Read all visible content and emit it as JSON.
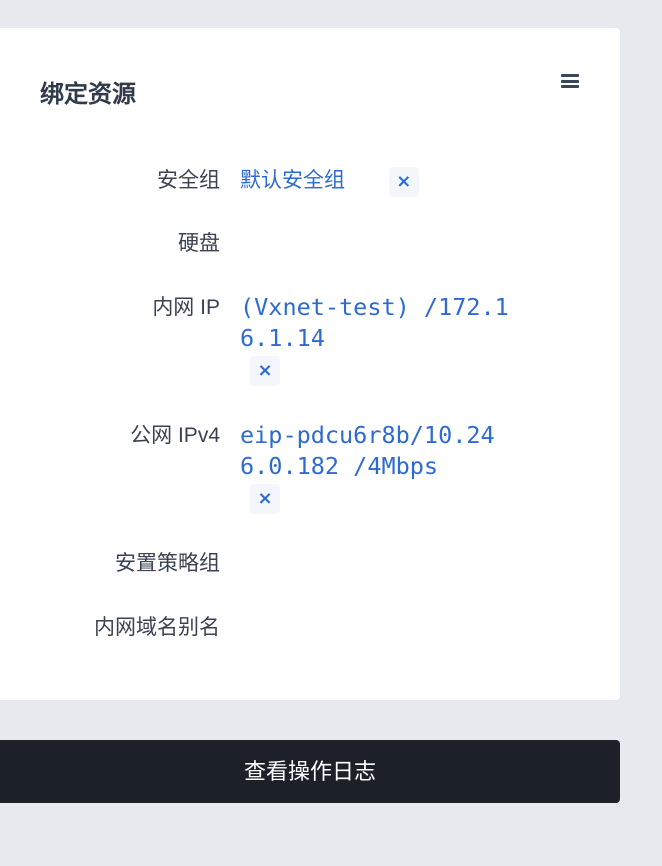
{
  "card": {
    "title": "绑定资源",
    "menu_icon": "hamburger-icon",
    "rows": [
      {
        "label": "安全组",
        "value": "默认安全组",
        "removable": true
      },
      {
        "label": "硬盘",
        "value": ""
      },
      {
        "label": "内网 IP",
        "value": "(Vxnet-test) /172.16.1.14",
        "removable": true
      },
      {
        "label": "公网 IPv4",
        "value": "eip-pdcu6r8b/10.246.0.182 /4Mbps",
        "removable": true
      },
      {
        "label": "安置策略组",
        "value": ""
      },
      {
        "label": "内网域名别名",
        "value": ""
      }
    ],
    "remove_glyph": "×"
  },
  "log_button": "查看操作日志"
}
